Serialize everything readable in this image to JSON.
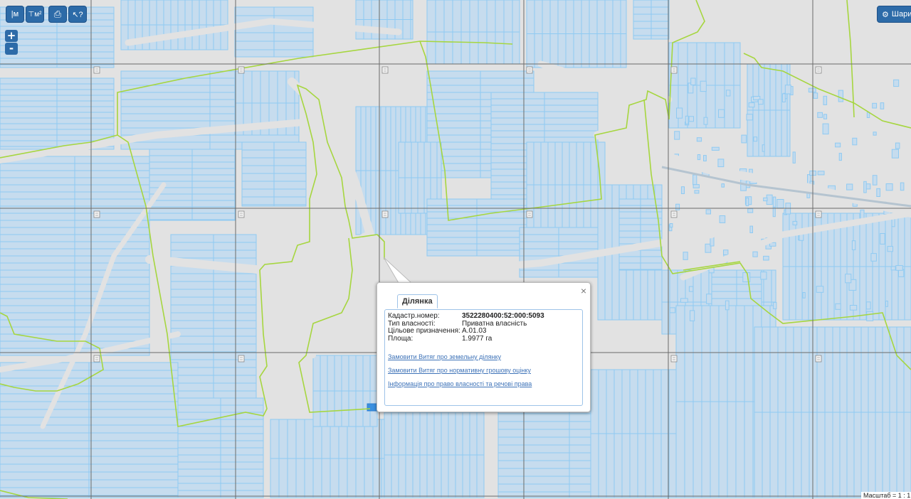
{
  "toolbar": {
    "items": [
      {
        "icon": "measure-length-icon",
        "glyph": "|м"
      },
      {
        "icon": "measure-area-icon",
        "glyph": "⊤м²"
      },
      {
        "icon": "print-icon",
        "glyph": "⎙"
      },
      {
        "icon": "identify-cursor-icon",
        "glyph": "↖?"
      }
    ]
  },
  "zoom": {
    "in_label": "+",
    "out_label": "-"
  },
  "layers": {
    "label": "Шари",
    "icon": "gear-icon"
  },
  "popup": {
    "tab_label": "Ділянка",
    "close_label": "×",
    "fields": [
      {
        "label": "Кадастр.номер:",
        "value": "3522280400:52:000:5093",
        "bold": true
      },
      {
        "label": "Тип власності:",
        "value": "Приватна власність"
      },
      {
        "label": "Цільове призначення:",
        "value": "A.01.03"
      },
      {
        "label": "Площа:",
        "value": "1.9977 га"
      }
    ],
    "links": [
      "Замовити Витяг про земельну ділянку",
      "Замовити Витяг про нормативну грошову оцінку",
      "Інформація про право власності та речові права"
    ]
  },
  "scale": {
    "label": "Масштаб = 1 : 1"
  },
  "colors": {
    "background": "#e2e2e2",
    "parcel_fill": "#c6dcee",
    "parcel_line": "#8fcaf2",
    "boundary": "#a6d63f",
    "grid": "#6b6b6b",
    "button": "#2d6ba8",
    "link": "#3e73b8"
  }
}
